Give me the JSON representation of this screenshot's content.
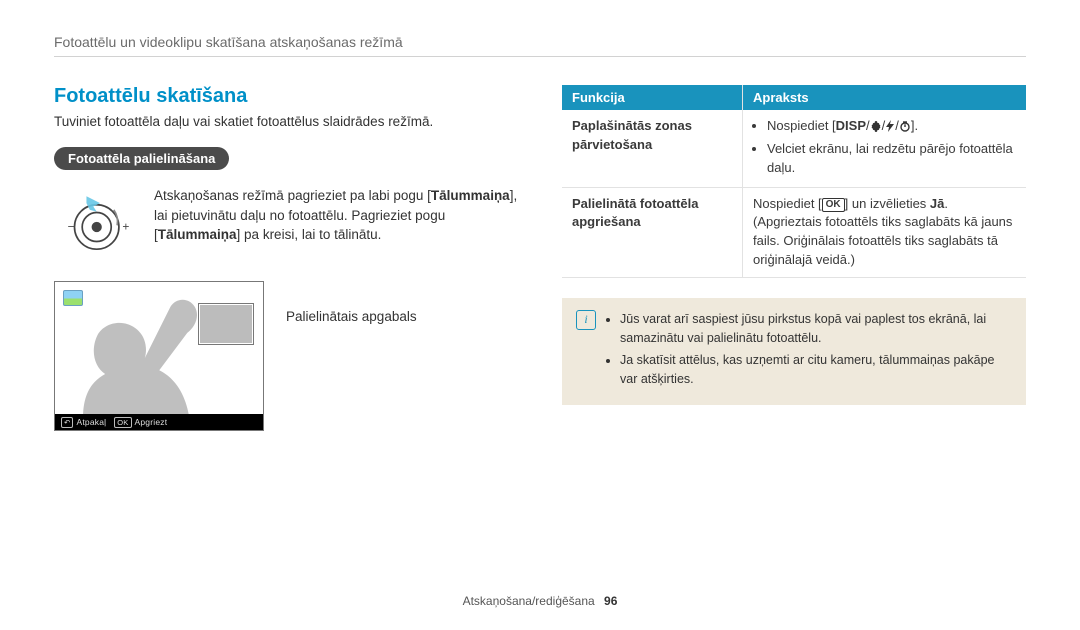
{
  "breadcrumb": "Fotoattēlu un videoklipu skatīšana atskaņošanas režīmā",
  "section_title": "Fotoattēlu skatīšana",
  "intro": "Tuviniet fotoattēla daļu vai skatiet fotoattēlus slaidrādes režīmā.",
  "pill": "Fotoattēla palielināšana",
  "dial_text_prefix": "Atskaņošanas režīmā pagrieziet pa labi pogu [",
  "dial_bold1": "Tālummaiņa",
  "dial_text_mid": "], lai pietuvinātu daļu no fotoattēlu. Pagrieziet pogu [",
  "dial_bold2": "Tālummaiņa",
  "dial_text_suffix": "] pa kreisi, lai to tālinātu.",
  "caption_right": "Palielinātais apgabals",
  "shot_footer": {
    "back_label": "Atpakaļ",
    "ok_label": "Apgriezt"
  },
  "table": {
    "head_func": "Funkcija",
    "head_desc": "Apraksts",
    "rows": [
      {
        "name": "Paplašinātās zonas pārvietošana",
        "desc_li1_label": "Nospiediet",
        "desc_li1_key": "DISP",
        "desc_li2": "Velciet ekrānu, lai redzētu pārējo fotoattēla daļu."
      },
      {
        "name": "Palielinātā fotoattēla apgriešana",
        "desc_prefix": "Nospiediet [",
        "ok": "OK",
        "desc_mid": "] un izvēlieties ",
        "desc_bold": "Jā",
        "desc_suffix": ". (Apgrieztais fotoattēls tiks saglabāts kā jauns fails. Oriģinālais fotoattēls tiks saglabāts tā oriģinālajā veidā.)"
      }
    ]
  },
  "note": {
    "li1": "Jūs varat arī saspiest jūsu pirkstus kopā vai paplest tos ekrānā, lai samazinātu vai palielinātu fotoattēlu.",
    "li2": "Ja skatīsit attēlus, kas uzņemti ar citu kameru, tālummaiņas pakāpe var atšķirties."
  },
  "footer": {
    "label": "Atskaņošana/rediģēšana",
    "page": "96"
  }
}
